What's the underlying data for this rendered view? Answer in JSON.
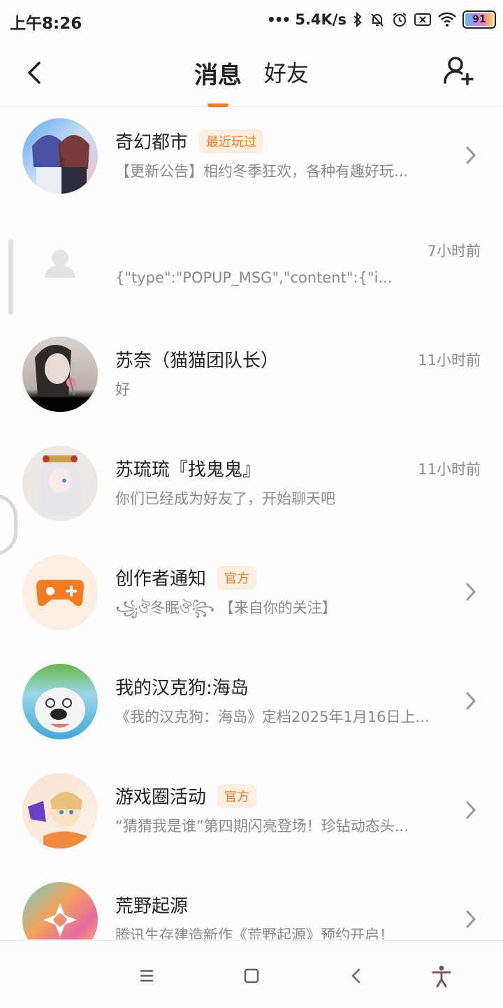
{
  "status": {
    "time": "上午8:26",
    "speed": "5.4K/s",
    "battery": "91"
  },
  "header": {
    "tabs": [
      "消息",
      "好友"
    ],
    "active_tab": 0
  },
  "messages": [
    {
      "name": "奇幻都市",
      "badge": "最近玩过",
      "preview": "【更新公告】相约冬季狂欢，各种有趣好玩...",
      "time": "",
      "avatar": "anime-duo"
    },
    {
      "name": "",
      "badge": "",
      "preview": "{\"type\":\"POPUP_MSG\",\"content\":{\"i...",
      "time": "7小时前",
      "avatar": "default-user"
    },
    {
      "name": "苏奈（猫猫团队长）",
      "badge": "",
      "preview": "好",
      "time": "11小时前",
      "avatar": "woman-flower"
    },
    {
      "name": "苏琉琉『找鬼鬼』",
      "badge": "",
      "preview": "你们已经成为好友了，开始聊天吧",
      "time": "11小时前",
      "avatar": "white-hair-girl"
    },
    {
      "name": "创作者通知",
      "badge": "官方",
      "preview": "꧁ঔ冬眠ঔ꧂ 【来自你的关注】",
      "time": "",
      "avatar": "gamepad-plus"
    },
    {
      "name": "我的汉克狗:海岛",
      "badge": "",
      "preview": "《我的汉克狗：海岛》定档2025年1月16日上...",
      "time": "",
      "avatar": "cartoon-dog"
    },
    {
      "name": "游戏圈活动",
      "badge": "官方",
      "preview": "“猜猜我是谁”第四期闪亮登场！珍钻动态头...",
      "time": "",
      "avatar": "megaphone-girl"
    },
    {
      "name": "荒野起源",
      "badge": "",
      "preview": "腾讯生存建造新作《荒野起源》预约开启！",
      "time": "",
      "avatar": "colorful-emblem"
    }
  ],
  "colors": {
    "accent": "#f47b20",
    "badge_bg": "#fdeee2"
  }
}
